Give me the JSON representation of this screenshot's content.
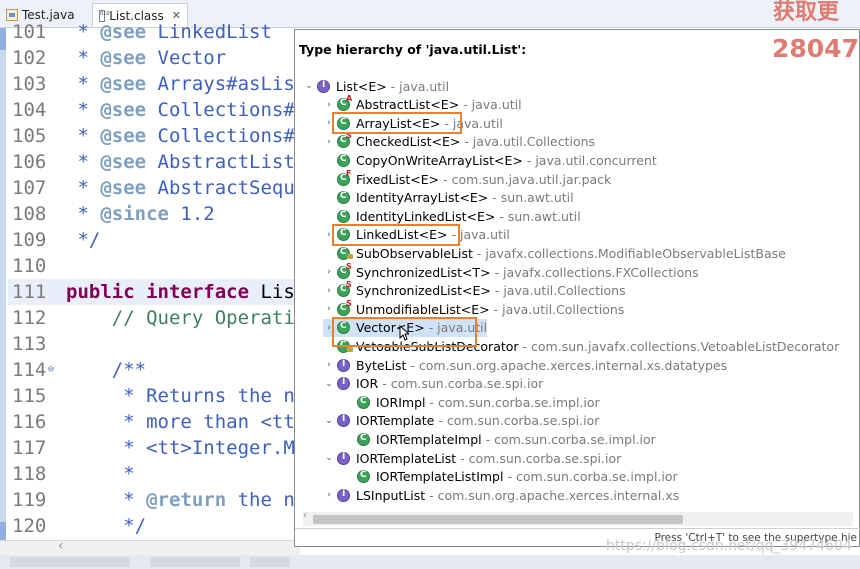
{
  "tabs": [
    {
      "label": "Test.java",
      "icon": "java-file-icon"
    },
    {
      "label": "List.class",
      "icon": "class-file-icon",
      "close": "✕"
    }
  ],
  "corner_overlay": "获取更",
  "editor": {
    "lines": [
      {
        "num": "101",
        "parts": [
          {
            "t": " * ",
            "c": "c-doc"
          },
          {
            "t": "@see",
            "c": "c-tag"
          },
          {
            "t": " LinkedList",
            "c": "c-doc"
          }
        ]
      },
      {
        "num": "102",
        "parts": [
          {
            "t": " * ",
            "c": "c-doc"
          },
          {
            "t": "@see",
            "c": "c-tag"
          },
          {
            "t": " Vector",
            "c": "c-doc"
          }
        ]
      },
      {
        "num": "103",
        "parts": [
          {
            "t": " * ",
            "c": "c-doc"
          },
          {
            "t": "@see",
            "c": "c-tag"
          },
          {
            "t": " Arrays#asLis",
            "c": "c-doc"
          }
        ]
      },
      {
        "num": "104",
        "parts": [
          {
            "t": " * ",
            "c": "c-doc"
          },
          {
            "t": "@see",
            "c": "c-tag"
          },
          {
            "t": " Collections#",
            "c": "c-doc"
          }
        ]
      },
      {
        "num": "105",
        "parts": [
          {
            "t": " * ",
            "c": "c-doc"
          },
          {
            "t": "@see",
            "c": "c-tag"
          },
          {
            "t": " Collections#",
            "c": "c-doc"
          }
        ]
      },
      {
        "num": "106",
        "parts": [
          {
            "t": " * ",
            "c": "c-doc"
          },
          {
            "t": "@see",
            "c": "c-tag"
          },
          {
            "t": " AbstractList",
            "c": "c-doc"
          }
        ]
      },
      {
        "num": "107",
        "parts": [
          {
            "t": " * ",
            "c": "c-doc"
          },
          {
            "t": "@see",
            "c": "c-tag"
          },
          {
            "t": " AbstractSequ",
            "c": "c-doc"
          }
        ]
      },
      {
        "num": "108",
        "parts": [
          {
            "t": " * ",
            "c": "c-doc"
          },
          {
            "t": "@since",
            "c": "c-tag"
          },
          {
            "t": " 1.2",
            "c": "c-doc"
          }
        ]
      },
      {
        "num": "109",
        "parts": [
          {
            "t": " */",
            "c": "c-doc"
          }
        ]
      },
      {
        "num": "110",
        "parts": []
      },
      {
        "num": "111",
        "parts": [
          {
            "t": "public",
            "c": "c-kw"
          },
          {
            "t": " ",
            "c": "c-plain"
          },
          {
            "t": "interface",
            "c": "c-kw"
          },
          {
            "t": " Lis",
            "c": "c-plain"
          }
        ],
        "highlight": true
      },
      {
        "num": "112",
        "parts": [
          {
            "t": "    // Query Operati",
            "c": "c-cmt"
          }
        ]
      },
      {
        "num": "113",
        "parts": []
      },
      {
        "num": "114",
        "parts": [
          {
            "t": "    /**",
            "c": "c-doc"
          }
        ],
        "fold": "⊖"
      },
      {
        "num": "115",
        "parts": [
          {
            "t": "     * Returns the n",
            "c": "c-doc"
          }
        ]
      },
      {
        "num": "116",
        "parts": [
          {
            "t": "     * more than <tt",
            "c": "c-doc"
          }
        ]
      },
      {
        "num": "117",
        "parts": [
          {
            "t": "     * <tt>Integer.M",
            "c": "c-doc"
          }
        ]
      },
      {
        "num": "118",
        "parts": [
          {
            "t": "     *",
            "c": "c-doc"
          }
        ]
      },
      {
        "num": "119",
        "parts": [
          {
            "t": "     * ",
            "c": "c-doc"
          },
          {
            "t": "@return",
            "c": "c-tag"
          },
          {
            "t": " the n",
            "c": "c-doc"
          }
        ]
      },
      {
        "num": "120",
        "parts": [
          {
            "t": "     */",
            "c": "c-doc"
          }
        ]
      }
    ]
  },
  "popup": {
    "title": "Type hierarchy of 'java.util.List':",
    "overlay_number": "28047",
    "status": "Press 'Ctrl+T' to see the supertype hie",
    "rows": [
      {
        "exp": "⌄",
        "icon": "intf",
        "badge": "",
        "name": "List<E>",
        "pkg": "- java.util",
        "indent": 0
      },
      {
        "exp": "›",
        "icon": "cls",
        "badge": "A",
        "name": "AbstractList<E>",
        "pkg": "- java.util",
        "indent": 1
      },
      {
        "exp": "›",
        "icon": "cls",
        "badge": "",
        "name": "ArrayList<E>",
        "pkg": "- java.util",
        "indent": 1
      },
      {
        "exp": "›",
        "icon": "cls",
        "badge": "S",
        "name": "CheckedList<E>",
        "pkg": "- java.util.Collections",
        "indent": 1
      },
      {
        "exp": "",
        "icon": "cls",
        "badge": "",
        "name": "CopyOnWriteArrayList<E>",
        "pkg": "- java.util.concurrent",
        "indent": 1
      },
      {
        "exp": "",
        "icon": "cls",
        "badge": "F",
        "name": "FixedList<E>",
        "pkg": "- com.sun.java.util.jar.pack",
        "indent": 1
      },
      {
        "exp": "",
        "icon": "cls",
        "badge": "",
        "name": "IdentityArrayList<E>",
        "pkg": "- sun.awt.util",
        "indent": 1
      },
      {
        "exp": "",
        "icon": "cls",
        "badge": "",
        "name": "IdentityLinkedList<E>",
        "pkg": "- sun.awt.util",
        "indent": 1
      },
      {
        "exp": "›",
        "icon": "cls",
        "badge": "",
        "name": "LinkedList<E>",
        "pkg": "- java.util",
        "indent": 1
      },
      {
        "exp": "",
        "icon": "cls",
        "badge": "lock",
        "name": "SubObservableList",
        "pkg": "- javafx.collections.ModifiableObservableListBase",
        "indent": 1
      },
      {
        "exp": "›",
        "icon": "cls",
        "badge": "S",
        "name": "SynchronizedList<T>",
        "pkg": "- javafx.collections.FXCollections",
        "indent": 1
      },
      {
        "exp": "›",
        "icon": "cls",
        "badge": "S",
        "name": "SynchronizedList<E>",
        "pkg": "- java.util.Collections",
        "indent": 1
      },
      {
        "exp": "›",
        "icon": "cls",
        "badge": "S",
        "name": "UnmodifiableList<E>",
        "pkg": "- java.util.Collections",
        "indent": 1
      },
      {
        "exp": "›",
        "icon": "cls",
        "badge": "",
        "name": "Vector<E>",
        "pkg": "- java.util",
        "indent": 1,
        "selected": true
      },
      {
        "exp": "",
        "icon": "cls",
        "badge": "lock",
        "name": "VetoableSubListDecorator",
        "pkg": "- com.sun.javafx.collections.VetoableListDecorator",
        "indent": 1
      },
      {
        "exp": "›",
        "icon": "intf",
        "badge": "",
        "name": "ByteList",
        "pkg": "- com.sun.org.apache.xerces.internal.xs.datatypes",
        "indent": 1
      },
      {
        "exp": "⌄",
        "icon": "intf",
        "badge": "",
        "name": "IOR",
        "pkg": "- com.sun.corba.se.spi.ior",
        "indent": 1
      },
      {
        "exp": "",
        "icon": "cls",
        "badge": "",
        "name": "IORImpl",
        "pkg": "- com.sun.corba.se.impl.ior",
        "indent": 2
      },
      {
        "exp": "⌄",
        "icon": "intf",
        "badge": "",
        "name": "IORTemplate",
        "pkg": "- com.sun.corba.se.spi.ior",
        "indent": 1
      },
      {
        "exp": "",
        "icon": "cls",
        "badge": "",
        "name": "IORTemplateImpl",
        "pkg": "- com.sun.corba.se.impl.ior",
        "indent": 2
      },
      {
        "exp": "⌄",
        "icon": "intf",
        "badge": "",
        "name": "IORTemplateList",
        "pkg": "- com.sun.corba.se.spi.ior",
        "indent": 1
      },
      {
        "exp": "",
        "icon": "cls",
        "badge": "",
        "name": "IORTemplateListImpl",
        "pkg": "- com.sun.corba.se.impl.ior",
        "indent": 2
      },
      {
        "exp": "›",
        "icon": "intf",
        "badge": "",
        "name": "LSInputList",
        "pkg": "- com.sun.org.apache.xerces.internal.xs",
        "indent": 1
      }
    ]
  },
  "watermark": "https://blog.csdn.net/qq_39474604"
}
